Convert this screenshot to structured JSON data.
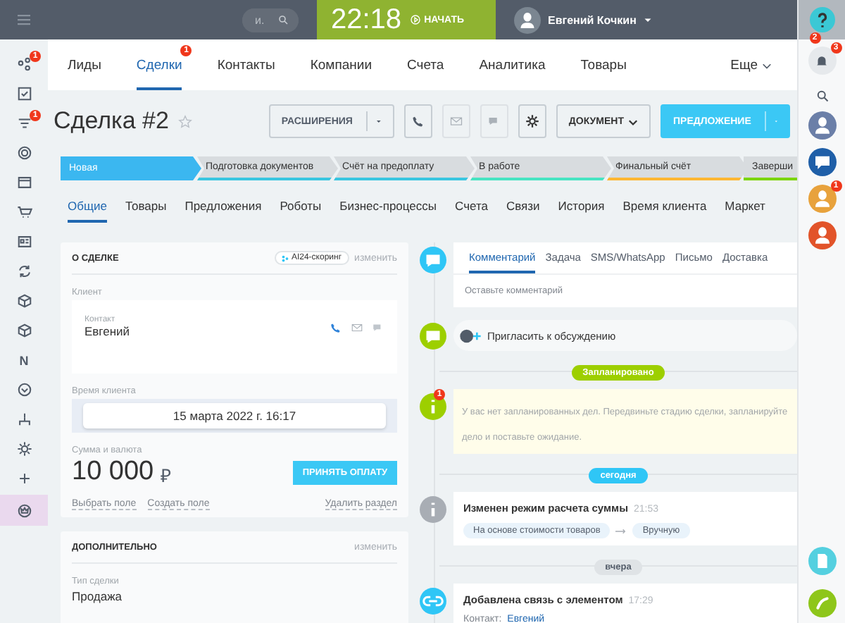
{
  "topbar": {
    "search_placeholder": "и.",
    "clock": "22:18",
    "start_button": "НАЧАТЬ",
    "user_name": "Евгений Кочкин"
  },
  "left_sidebar": [
    {
      "kind": "people",
      "badge": "1",
      "selected": false
    },
    {
      "kind": "check",
      "selected": false
    },
    {
      "kind": "filter",
      "badge": "1",
      "selected": false
    },
    {
      "kind": "target",
      "selected": false
    },
    {
      "kind": "window",
      "selected": false
    },
    {
      "kind": "cart",
      "selected": false
    },
    {
      "kind": "card",
      "selected": false
    },
    {
      "kind": "sync",
      "selected": false
    },
    {
      "kind": "cube",
      "selected": false
    },
    {
      "kind": "cube",
      "selected": false
    },
    {
      "kind": "letter",
      "label": "N",
      "selected": false
    },
    {
      "kind": "chevron",
      "selected": false
    },
    {
      "kind": "sitemap",
      "selected": false
    },
    {
      "kind": "gear",
      "selected": false
    },
    {
      "kind": "plus",
      "selected": false
    },
    {
      "kind": "crown",
      "selected": true
    }
  ],
  "nav_tabs": [
    {
      "label": "Лиды",
      "selected": false
    },
    {
      "label": "Сделки",
      "selected": true,
      "badge": "1"
    },
    {
      "label": "Контакты",
      "selected": false
    },
    {
      "label": "Компании",
      "selected": false
    },
    {
      "label": "Счета",
      "selected": false
    },
    {
      "label": "Аналитика",
      "selected": false
    },
    {
      "label": "Товары",
      "selected": false
    }
  ],
  "nav_more": "Еще",
  "title": "Сделка #2",
  "toolbar": {
    "extensions": "РАСШИРЕНИЯ",
    "document": "ДОКУМЕНТ",
    "proposal": "ПРЕДЛОЖЕНИЕ"
  },
  "stages": [
    {
      "label": "Новая",
      "color": "#3bb7f0",
      "selected": true
    },
    {
      "label": "Подготовка документов",
      "color": "#39c6e0",
      "selected": false
    },
    {
      "label": "Счёт на предоплату",
      "color": "#39c6e0",
      "selected": false
    },
    {
      "label": "В работе",
      "color": "#47e4c2",
      "selected": false
    },
    {
      "label": "Финальный счёт",
      "color": "#fdb733",
      "selected": false
    },
    {
      "label": "Заверши",
      "color": "#7bd500",
      "selected": false
    }
  ],
  "sub_tabs": [
    {
      "label": "Общие",
      "selected": true
    },
    {
      "label": "Товары",
      "selected": false
    },
    {
      "label": "Предложения",
      "selected": false
    },
    {
      "label": "Роботы",
      "selected": false
    },
    {
      "label": "Бизнес-процессы",
      "selected": false
    },
    {
      "label": "Счета",
      "selected": false
    },
    {
      "label": "Связи",
      "selected": false
    },
    {
      "label": "История",
      "selected": false
    },
    {
      "label": "Время клиента",
      "selected": false
    },
    {
      "label": "Маркет",
      "selected": false
    }
  ],
  "deal_card": {
    "heading": "О СДЕЛКЕ",
    "scoring": "AI24-скоринг",
    "edit": "изменить",
    "client_label": "Клиент",
    "contact_label": "Контакт",
    "contact_name": "Евгений",
    "time_label": "Время клиента",
    "time_value": "15 марта 2022 г. 16:17",
    "sum_label": "Сумма и валюта",
    "sum_value": "10 000",
    "currency": "₽",
    "pay_button": "ПРИНЯТЬ ОПЛАТУ",
    "links": [
      "Выбрать поле",
      "Создать поле"
    ],
    "delete_link": "Удалить раздел"
  },
  "extra_card": {
    "heading": "ДОПОЛНИТЕЛЬНО",
    "edit": "изменить",
    "field_label": "Тип сделки",
    "field_value": "Продажа"
  },
  "timeline": [
    {
      "kind": "composer",
      "tabs": [
        {
          "label": "Комментарий",
          "selected": true
        },
        {
          "label": "Задача",
          "selected": false
        },
        {
          "label": "SMS/WhatsApp",
          "selected": false
        },
        {
          "label": "Письмо",
          "selected": false
        },
        {
          "label": "Доставка",
          "selected": false
        }
      ],
      "placeholder": "Оставьте комментарий"
    },
    {
      "kind": "invite",
      "text": "Пригласить к обсуждению"
    },
    {
      "kind": "divider",
      "text": "Запланировано",
      "color": "#9dcf00"
    },
    {
      "kind": "note",
      "badge": "1",
      "text": "У вас нет запланированных дел. Передвиньте стадию сделки, запланируйте дело и поставьте ожидание."
    },
    {
      "kind": "divider",
      "text": "сегодня",
      "color": "#2fc6f6"
    },
    {
      "kind": "info_event",
      "title": "Изменен режим расчета суммы",
      "time": "21:53",
      "from": "На основе стоимости товаров",
      "to": "Вручную"
    },
    {
      "kind": "divider",
      "text": "вчера",
      "color": "#dfe3e6"
    },
    {
      "kind": "link_event",
      "title": "Добавлена связь с элементом",
      "time": "17:29",
      "link_label": "Контакт:",
      "link_text": "Евгений"
    }
  ],
  "right_sidebar": {
    "help_badge": "2",
    "bell_badge": "3",
    "avatars": [
      {
        "kind": "avatar",
        "color": "#6b7fa8"
      },
      {
        "kind": "chat",
        "color": "#1f5fa8"
      },
      {
        "kind": "avatar",
        "color": "#e8a23c",
        "badge": "1"
      },
      {
        "kind": "user",
        "color": "#e2542a"
      }
    ]
  }
}
